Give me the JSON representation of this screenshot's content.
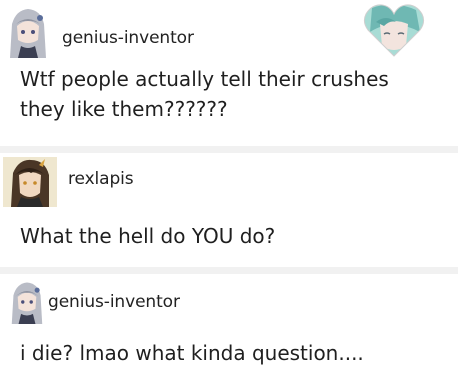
{
  "posts": [
    {
      "username": "genius-inventor",
      "avatar": "silver-haired-girl-avatar-icon",
      "lines": [
        "Wtf people actually tell their crushes",
        "they like them??????"
      ],
      "decoration": "teal-heart-portrait-icon"
    },
    {
      "username": "rexlapis",
      "avatar": "brown-haired-boy-avatar-icon",
      "lines": [
        "What the hell do YOU do?"
      ]
    },
    {
      "username": "genius-inventor",
      "avatar": "silver-haired-girl-avatar-icon",
      "lines": [
        "i die? lmao what kinda question...."
      ]
    }
  ],
  "colors": {
    "text": "#1f1f1f",
    "divider": "#f1f1f1",
    "heart_teal": "#a8dcd5"
  }
}
